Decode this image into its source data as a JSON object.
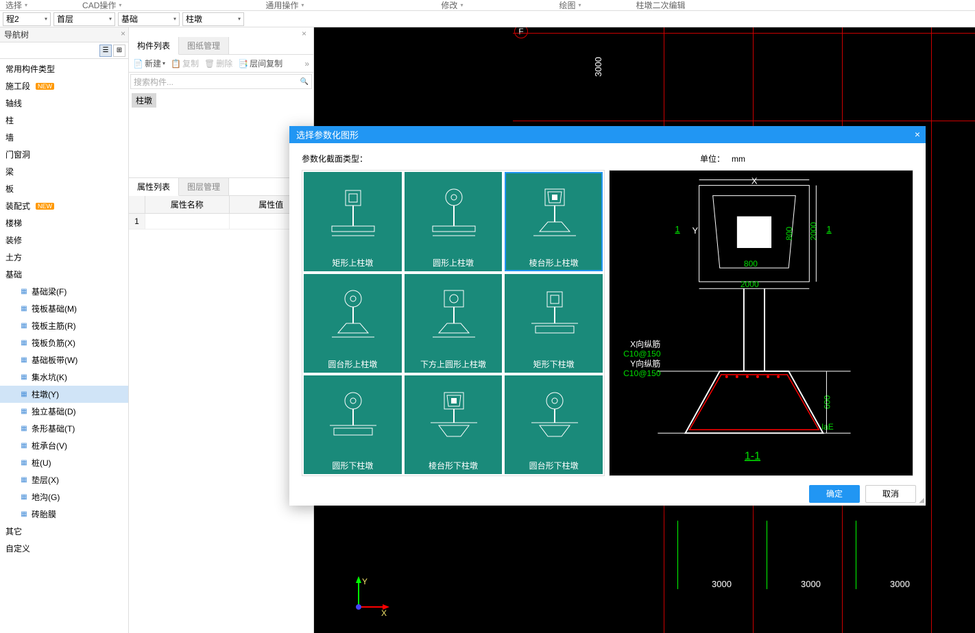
{
  "toolbar": {
    "items": [
      "选择",
      "CAD操作",
      "通用操作",
      "修改",
      "绘图",
      "柱墩二次编辑"
    ]
  },
  "selectors": {
    "project": "程2",
    "floor": "首层",
    "category": "基础",
    "component": "柱墩"
  },
  "navPanel": {
    "title": "导航树"
  },
  "navTree": {
    "items": [
      {
        "label": "常用构件类型"
      },
      {
        "label": "施工段",
        "badge": "NEW"
      },
      {
        "label": "轴线"
      },
      {
        "label": "柱"
      },
      {
        "label": "墙"
      },
      {
        "label": "门窗洞"
      },
      {
        "label": "梁"
      },
      {
        "label": "板"
      },
      {
        "label": "装配式",
        "badge": "NEW"
      },
      {
        "label": "楼梯"
      },
      {
        "label": "装修"
      },
      {
        "label": "土方"
      },
      {
        "label": "基础",
        "children": [
          {
            "label": "基础梁(F)"
          },
          {
            "label": "筏板基础(M)"
          },
          {
            "label": "筏板主筋(R)"
          },
          {
            "label": "筏板负筋(X)"
          },
          {
            "label": "基础板带(W)"
          },
          {
            "label": "集水坑(K)"
          },
          {
            "label": "柱墩(Y)",
            "selected": true
          },
          {
            "label": "独立基础(D)"
          },
          {
            "label": "条形基础(T)"
          },
          {
            "label": "桩承台(V)"
          },
          {
            "label": "桩(U)"
          },
          {
            "label": "垫层(X)"
          },
          {
            "label": "地沟(G)"
          },
          {
            "label": "砖胎膜"
          }
        ]
      },
      {
        "label": "其它"
      },
      {
        "label": "自定义"
      }
    ]
  },
  "componentsPanel": {
    "tabs": [
      "构件列表",
      "图纸管理"
    ],
    "btns": {
      "new": "新建",
      "copy": "复制",
      "delete": "删除",
      "floorCopy": "层间复制"
    },
    "searchPlaceholder": "搜索构件...",
    "item": "柱墩"
  },
  "propsPanel": {
    "tabs": [
      "属性列表",
      "图层管理"
    ],
    "headers": {
      "num": "",
      "name": "属性名称",
      "value": "属性值"
    },
    "row1": "1"
  },
  "canvas": {
    "dim3000v": "3000",
    "dim3000a": "3000",
    "dim3000b": "3000",
    "dim3000c": "3000",
    "labelF": "F",
    "axisX": "X",
    "axisY": "Y"
  },
  "modal": {
    "title": "选择参数化图形",
    "sectionTypeLabel": "参数化截面类型：",
    "unitLabel": "单位：",
    "unit": "mm",
    "shapes": [
      "矩形上柱墩",
      "圆形上柱墩",
      "棱台形上柱墩",
      "圆台形上柱墩",
      "下方上圆形上柱墩",
      "矩形下柱墩",
      "圆形下柱墩",
      "棱台形下柱墩",
      "圆台形下柱墩"
    ],
    "selectedIndex": 2,
    "preview": {
      "X": "X",
      "Y": "Y",
      "one_a": "1",
      "one_b": "1",
      "d800": "800",
      "d800b": "800",
      "d2000a": "2000",
      "d2000b": "2000",
      "xrebar": "X向纵筋",
      "xspec": "C10@150",
      "yrebar": "Y向纵筋",
      "yspec": "C10@150",
      "d600": "600",
      "laE": "laE",
      "section": "1-1"
    },
    "ok": "确定",
    "cancel": "取消"
  }
}
